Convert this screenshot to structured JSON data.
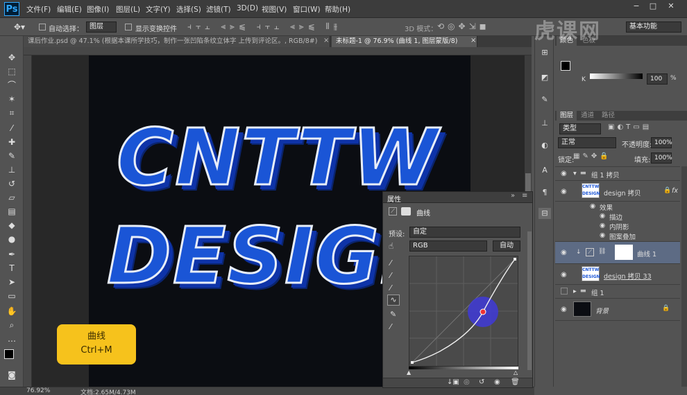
{
  "menubar": {
    "logo": "Ps",
    "items": [
      "文件(F)",
      "编辑(E)",
      "图像(I)",
      "图层(L)",
      "文字(Y)",
      "选择(S)",
      "滤镜(T)",
      "3D(D)",
      "视图(V)",
      "窗口(W)",
      "帮助(H)"
    ],
    "window_buttons": [
      "−",
      "□",
      "✕"
    ]
  },
  "options": {
    "auto_select_label": "自动选择：",
    "auto_select_value": "图层",
    "show_transform_label": "显示变换控件",
    "mode3d_label": "3D 模式：",
    "workspace": "基本功能"
  },
  "tabs": [
    {
      "label": "课后作业.psd @ 47.1% (根据本课所学技巧，制作一张凹陷条纹立体字 上传到评论区。, RGB/8#)",
      "close": "×"
    },
    {
      "label": "未标题-1 @ 76.9% (曲线 1, 图层蒙版/8)",
      "close": "×"
    }
  ],
  "canvas": {
    "line1": "CNTTW",
    "line2": "DESIGN"
  },
  "badge": {
    "title": "曲线",
    "shortcut": "Ctrl+M"
  },
  "status": {
    "zoom": "76.92%",
    "doc": "文档:2.65M/4.73M"
  },
  "properties": {
    "tab": "属性",
    "title": "曲线",
    "preset_label": "预设:",
    "preset_value": "自定",
    "channel": "RGB",
    "auto_button": "自动"
  },
  "swatch": {
    "tabs": [
      "颜色",
      "色板"
    ],
    "k_label": "K",
    "k_value": "100",
    "k_unit": "%"
  },
  "layers": {
    "tabs": [
      "图层",
      "通道",
      "路径"
    ],
    "kind": "类型",
    "blend": "正常",
    "opacity_label": "不透明度:",
    "opacity_value": "100%",
    "lock_label": "锁定:",
    "fill_label": "填充:",
    "fill_value": "100%",
    "items": [
      {
        "name": "组 1 拷贝"
      },
      {
        "name": "design 拷贝",
        "fx": "fx"
      },
      {
        "name": "效果"
      },
      {
        "name": "描边"
      },
      {
        "name": "内阴影"
      },
      {
        "name": "图案叠加"
      },
      {
        "name": "曲线 1"
      },
      {
        "name": "design 拷贝 33"
      },
      {
        "name": "组 1"
      },
      {
        "name": "背景"
      }
    ]
  },
  "watermark": "虎课网",
  "colors": {
    "accent": "#1a55d6",
    "badge": "#f6c21c",
    "selected_layer": "#5d6b84"
  }
}
